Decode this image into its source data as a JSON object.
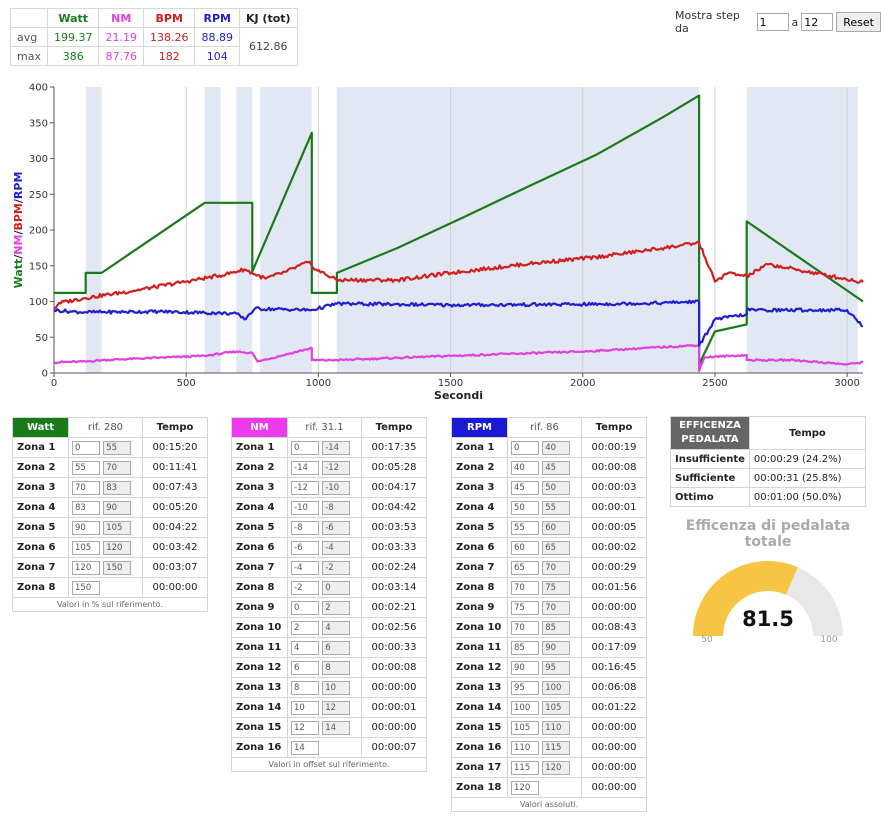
{
  "summary": {
    "headers": [
      "Watt",
      "NM",
      "BPM",
      "RPM",
      "KJ (tot)"
    ],
    "rows": [
      {
        "label": "avg",
        "values": [
          "199.37",
          "21.19",
          "138.26",
          "88.89"
        ]
      },
      {
        "label": "max",
        "values": [
          "386",
          "87.76",
          "182",
          "104"
        ]
      }
    ],
    "kj_total": "612.86"
  },
  "steps": {
    "label": "Mostra step da",
    "from": "1",
    "sep": "a",
    "to": "12",
    "reset": "Reset"
  },
  "chart_data": {
    "type": "line",
    "xlabel": "Secondi",
    "ylabel": "Watt/NM/BPM/RPM",
    "xlim": [
      0,
      3060
    ],
    "ylim": [
      0,
      400
    ],
    "x_ticks": [
      "0",
      "500",
      "1000",
      "1500",
      "2000",
      "2500",
      "3000"
    ],
    "y_ticks": [
      "0",
      "50",
      "100",
      "150",
      "200",
      "250",
      "300",
      "350",
      "400"
    ],
    "bands": [
      [
        120,
        180
      ],
      [
        570,
        630
      ],
      [
        690,
        750
      ],
      [
        780,
        975
      ],
      [
        1070,
        2440
      ],
      [
        2620,
        3040
      ]
    ],
    "series": [
      {
        "name": "Watt",
        "color": "#1a7a1a",
        "points": [
          [
            0,
            112
          ],
          [
            120,
            112
          ],
          [
            120,
            140
          ],
          [
            180,
            140
          ],
          [
            570,
            238
          ],
          [
            750,
            238
          ],
          [
            750,
            142
          ],
          [
            975,
            336
          ],
          [
            975,
            112
          ],
          [
            1070,
            112
          ],
          [
            1070,
            140
          ],
          [
            1300,
            175
          ],
          [
            1550,
            218
          ],
          [
            1800,
            262
          ],
          [
            2050,
            305
          ],
          [
            2300,
            357
          ],
          [
            2440,
            388
          ],
          [
            2440,
            12
          ],
          [
            2500,
            58
          ],
          [
            2620,
            68
          ],
          [
            2620,
            212
          ],
          [
            3060,
            100
          ]
        ]
      },
      {
        "name": "NM",
        "color": "#e040e0",
        "points": [
          [
            0,
            15
          ],
          [
            120,
            16
          ],
          [
            180,
            18
          ],
          [
            570,
            24
          ],
          [
            690,
            30
          ],
          [
            750,
            28
          ],
          [
            770,
            16
          ],
          [
            975,
            35
          ],
          [
            975,
            18
          ],
          [
            1070,
            18
          ],
          [
            1500,
            24
          ],
          [
            2000,
            30
          ],
          [
            2440,
            39
          ],
          [
            2440,
            3
          ],
          [
            2460,
            22
          ],
          [
            2620,
            25
          ],
          [
            2620,
            18
          ],
          [
            2800,
            18
          ],
          [
            3000,
            12
          ],
          [
            3060,
            15
          ]
        ]
      },
      {
        "name": "BPM",
        "color": "#d02020",
        "points": [
          [
            0,
            90
          ],
          [
            20,
            98
          ],
          [
            120,
            105
          ],
          [
            300,
            115
          ],
          [
            500,
            128
          ],
          [
            650,
            138
          ],
          [
            720,
            145
          ],
          [
            760,
            138
          ],
          [
            800,
            132
          ],
          [
            880,
            142
          ],
          [
            960,
            155
          ],
          [
            990,
            145
          ],
          [
            1070,
            130
          ],
          [
            1300,
            130
          ],
          [
            1500,
            140
          ],
          [
            1800,
            153
          ],
          [
            2050,
            162
          ],
          [
            2250,
            172
          ],
          [
            2440,
            182
          ],
          [
            2500,
            128
          ],
          [
            2550,
            140
          ],
          [
            2620,
            135
          ],
          [
            2700,
            152
          ],
          [
            3060,
            127
          ]
        ]
      },
      {
        "name": "RPM",
        "color": "#2020d0",
        "points": [
          [
            0,
            88
          ],
          [
            60,
            86
          ],
          [
            120,
            85
          ],
          [
            400,
            86
          ],
          [
            690,
            83
          ],
          [
            720,
            75
          ],
          [
            760,
            90
          ],
          [
            975,
            88
          ],
          [
            1070,
            97
          ],
          [
            1500,
            95
          ],
          [
            2000,
            96
          ],
          [
            2300,
            98
          ],
          [
            2440,
            100
          ],
          [
            2440,
            38
          ],
          [
            2500,
            75
          ],
          [
            2620,
            82
          ],
          [
            2620,
            88
          ],
          [
            3000,
            88
          ],
          [
            3060,
            65
          ]
        ]
      }
    ]
  },
  "watt_table": {
    "title": "Watt",
    "ref": "rif. 280",
    "time_header": "Tempo",
    "rows": [
      {
        "zone": "Zona 1",
        "a": "0",
        "b": "55",
        "time": "00:15:20"
      },
      {
        "zone": "Zona 2",
        "a": "55",
        "b": "70",
        "time": "00:11:41"
      },
      {
        "zone": "Zona 3",
        "a": "70",
        "b": "83",
        "time": "00:07:43"
      },
      {
        "zone": "Zona 4",
        "a": "83",
        "b": "90",
        "time": "00:05:20"
      },
      {
        "zone": "Zona 5",
        "a": "90",
        "b": "105",
        "time": "00:04:22"
      },
      {
        "zone": "Zona 6",
        "a": "105",
        "b": "120",
        "time": "00:03:42"
      },
      {
        "zone": "Zona 7",
        "a": "120",
        "b": "150",
        "time": "00:03:07"
      },
      {
        "zone": "Zona 8",
        "a": "150",
        "b": "",
        "time": "00:00:00"
      }
    ],
    "note": "Valori in % sul riferimento."
  },
  "nm_table": {
    "title": "NM",
    "ref": "rif. 31.1",
    "time_header": "Tempo",
    "rows": [
      {
        "zone": "Zona 1",
        "a": "0",
        "b": "-14",
        "time": "00:17:35"
      },
      {
        "zone": "Zona 2",
        "a": "-14",
        "b": "-12",
        "time": "00:05:28"
      },
      {
        "zone": "Zona 3",
        "a": "-12",
        "b": "-10",
        "time": "00:04:17"
      },
      {
        "zone": "Zona 4",
        "a": "-10",
        "b": "-8",
        "time": "00:04:42"
      },
      {
        "zone": "Zona 5",
        "a": "-8",
        "b": "-6",
        "time": "00:03:53"
      },
      {
        "zone": "Zona 6",
        "a": "-6",
        "b": "-4",
        "time": "00:03:33"
      },
      {
        "zone": "Zona 7",
        "a": "-4",
        "b": "-2",
        "time": "00:02:24"
      },
      {
        "zone": "Zona 8",
        "a": "-2",
        "b": "0",
        "time": "00:03:14"
      },
      {
        "zone": "Zona 9",
        "a": "0",
        "b": "2",
        "time": "00:02:21"
      },
      {
        "zone": "Zona 10",
        "a": "2",
        "b": "4",
        "time": "00:02:56"
      },
      {
        "zone": "Zona 11",
        "a": "4",
        "b": "6",
        "time": "00:00:33"
      },
      {
        "zone": "Zona 12",
        "a": "6",
        "b": "8",
        "time": "00:00:08"
      },
      {
        "zone": "Zona 13",
        "a": "8",
        "b": "10",
        "time": "00:00:00"
      },
      {
        "zone": "Zona 14",
        "a": "10",
        "b": "12",
        "time": "00:00:01"
      },
      {
        "zone": "Zona 15",
        "a": "12",
        "b": "14",
        "time": "00:00:00"
      },
      {
        "zone": "Zona 16",
        "a": "14",
        "b": "",
        "time": "00:00:07"
      }
    ],
    "note": "Valori in offset sul riferimento."
  },
  "rpm_table": {
    "title": "RPM",
    "ref": "rif. 86",
    "time_header": "Tempo",
    "rows": [
      {
        "zone": "Zona 1",
        "a": "0",
        "b": "40",
        "time": "00:00:19"
      },
      {
        "zone": "Zona 2",
        "a": "40",
        "b": "45",
        "time": "00:00:08"
      },
      {
        "zone": "Zona 3",
        "a": "45",
        "b": "50",
        "time": "00:00:03"
      },
      {
        "zone": "Zona 4",
        "a": "50",
        "b": "55",
        "time": "00:00:01"
      },
      {
        "zone": "Zona 5",
        "a": "55",
        "b": "60",
        "time": "00:00:05"
      },
      {
        "zone": "Zona 6",
        "a": "60",
        "b": "65",
        "time": "00:00:02"
      },
      {
        "zone": "Zona 7",
        "a": "65",
        "b": "70",
        "time": "00:00:29"
      },
      {
        "zone": "Zona 8",
        "a": "70",
        "b": "75",
        "time": "00:01:56"
      },
      {
        "zone": "Zona 9",
        "a": "75",
        "b": "70",
        "time": "00:00:00"
      },
      {
        "zone": "Zona 10",
        "a": "70",
        "b": "85",
        "time": "00:08:43"
      },
      {
        "zone": "Zona 11",
        "a": "85",
        "b": "90",
        "time": "00:17:09"
      },
      {
        "zone": "Zona 12",
        "a": "90",
        "b": "95",
        "time": "00:16:45"
      },
      {
        "zone": "Zona 13",
        "a": "95",
        "b": "100",
        "time": "00:06:08"
      },
      {
        "zone": "Zona 14",
        "a": "100",
        "b": "105",
        "time": "00:01:22"
      },
      {
        "zone": "Zona 15",
        "a": "105",
        "b": "110",
        "time": "00:00:00"
      },
      {
        "zone": "Zona 16",
        "a": "110",
        "b": "115",
        "time": "00:00:00"
      },
      {
        "zone": "Zona 17",
        "a": "115",
        "b": "120",
        "time": "00:00:00"
      },
      {
        "zone": "Zona 18",
        "a": "120",
        "b": "",
        "time": "00:00:00"
      }
    ],
    "note": "Valori assoluti."
  },
  "efficiency": {
    "header": "EFFICENZA PEDALATA",
    "time_header": "Tempo",
    "rows": [
      {
        "label": "Insufficiente",
        "value": "00:00:29 (24.2%)"
      },
      {
        "label": "Sufficiente",
        "value": "00:00:31 (25.8%)"
      },
      {
        "label": "Ottimo",
        "value": "00:01:00 (50.0%)"
      }
    ],
    "title": "Efficenza di pedalata totale",
    "gauge": {
      "value": 81.5,
      "display": "81.5",
      "min": 50,
      "max": 100,
      "min_label": "50",
      "max_label": "100",
      "fill_color": "#f7c444",
      "track_color": "#e8e8e8"
    }
  }
}
